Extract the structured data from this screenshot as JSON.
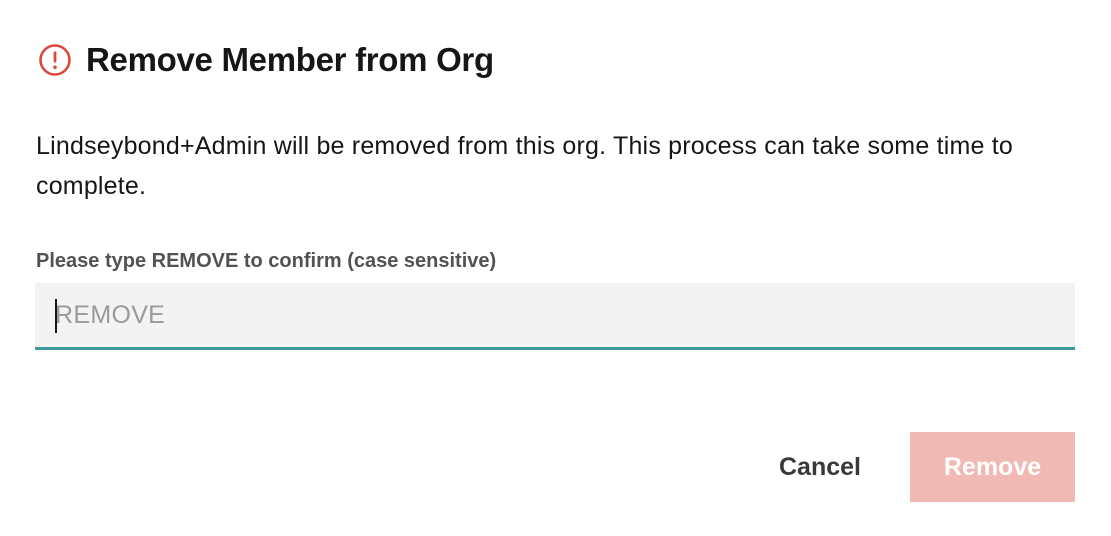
{
  "dialog": {
    "icon": "alert-circle-icon",
    "title": "Remove Member from Org",
    "message": "Lindseybond+Admin will be removed from this org. This process can take some time to complete.",
    "confirm_label": "Please type REMOVE to confirm (case sensitive)",
    "input": {
      "placeholder": "REMOVE",
      "value": ""
    },
    "cancel_label": "Cancel",
    "remove_label": "Remove",
    "remove_disabled": true
  },
  "colors": {
    "alert_icon": "#da4a3c",
    "input_underline": "#3d9a9a",
    "remove_button_disabled": "#f0b9b3",
    "title_text": "#161616",
    "label_text": "#525252"
  }
}
